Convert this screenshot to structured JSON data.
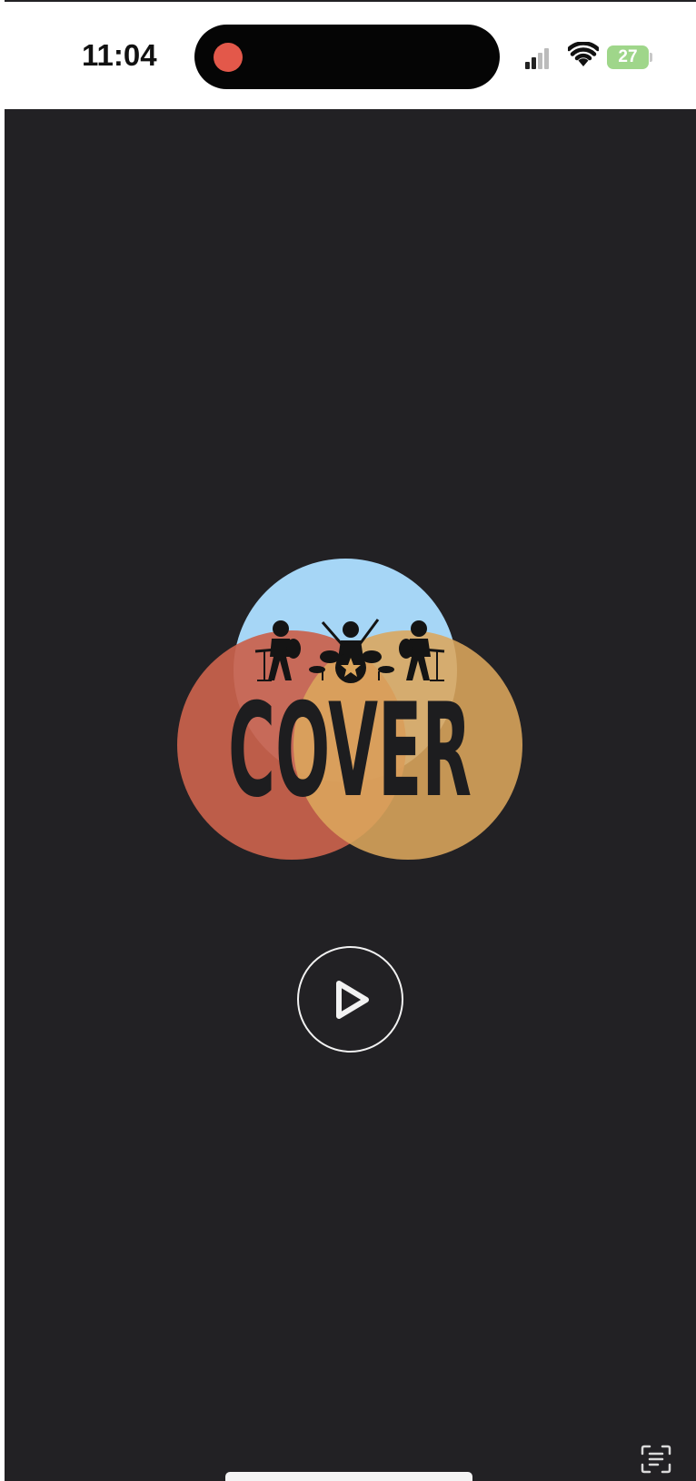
{
  "status_bar": {
    "time": "11:04",
    "battery_percent": "27",
    "recording_indicator": "recording-dot",
    "icons": [
      "signal-icon",
      "wifi-icon",
      "battery-charging-icon"
    ]
  },
  "logo": {
    "text": "COVER",
    "colors": {
      "sky": "#a6d6f6",
      "red": "#c9624c",
      "orange": "#dca65c",
      "text": "#1d1d1f",
      "background": "#222124"
    }
  },
  "player": {
    "control_icon": "play-icon",
    "button_color": "#f2f2f2"
  },
  "bottom": {
    "scan_icon": "text-scan-icon"
  }
}
